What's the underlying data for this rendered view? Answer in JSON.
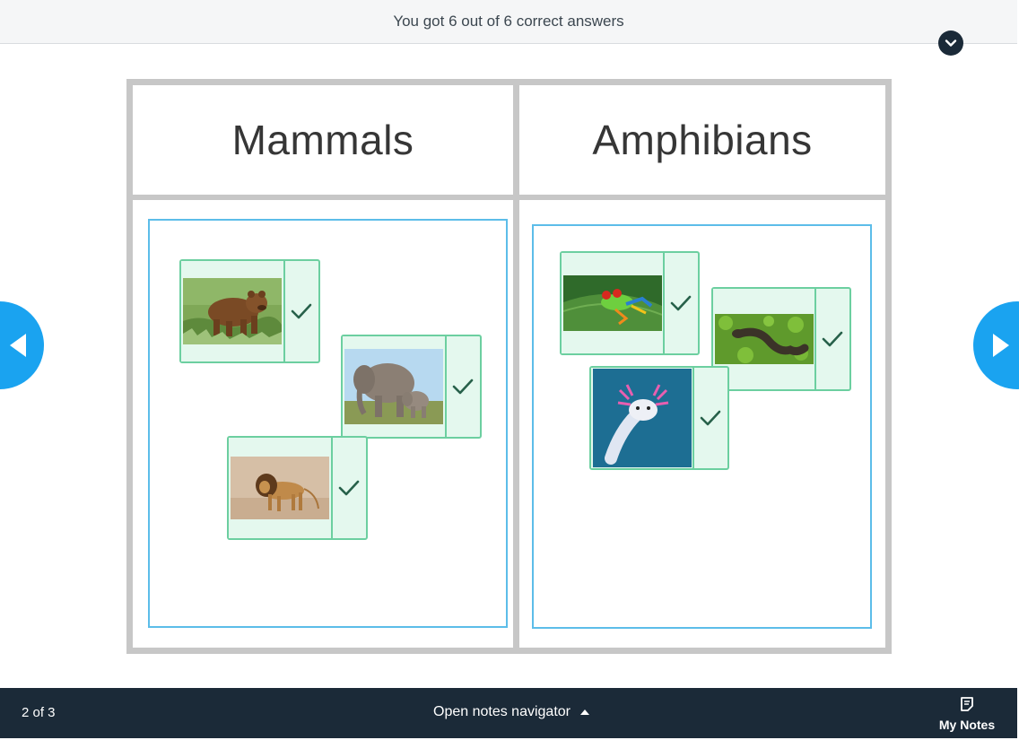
{
  "feedback": {
    "message": "You got 6 out of 6 correct answers"
  },
  "categories": [
    {
      "title": "Mammals",
      "items": [
        "Brown bear",
        "Elephant with calf",
        "Lion"
      ]
    },
    {
      "title": "Amphibians",
      "items": [
        "Red-eyed tree frog",
        "Salamander",
        "Axolotl"
      ]
    }
  ],
  "status": {
    "all_correct": true
  },
  "footer": {
    "page_indicator": "2 of 3",
    "notes_navigator": "Open notes navigator",
    "my_notes": "My Notes"
  },
  "colors": {
    "accent_blue": "#1aa3f0",
    "correct_green": "#6ccfa0",
    "correct_fill": "#e4f8ee",
    "dark_bar": "#1b2a38"
  }
}
